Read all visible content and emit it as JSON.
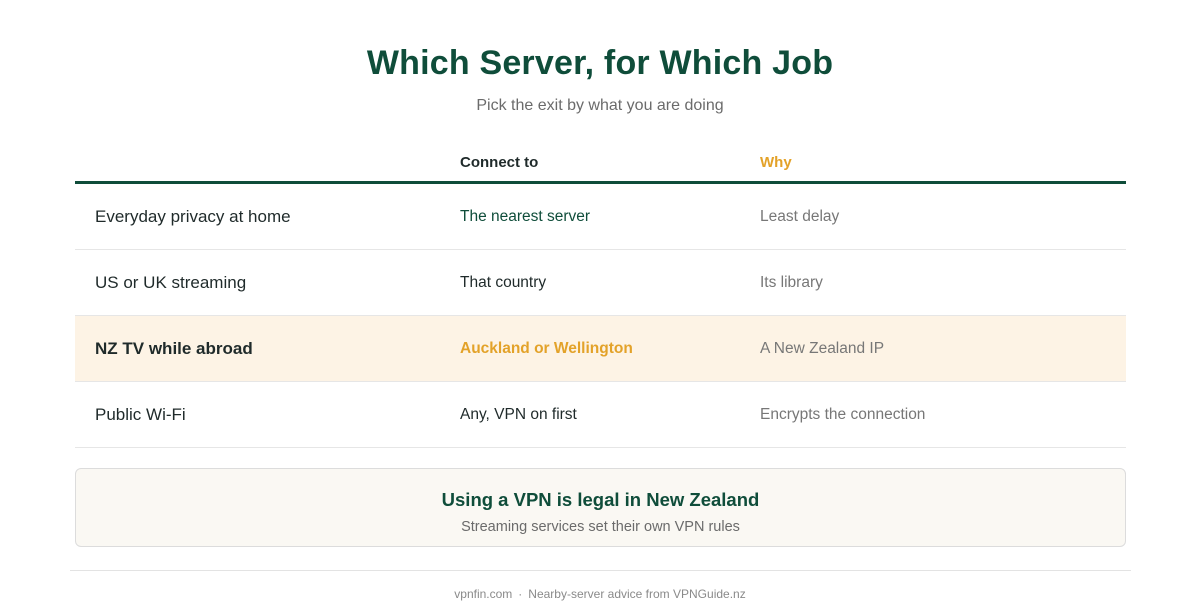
{
  "header": {
    "title": "Which Server, for Which Job",
    "subtitle": "Pick the exit by what you are doing"
  },
  "table": {
    "columns": {
      "job": "",
      "connect": "Connect to",
      "why": "Why"
    },
    "rows": [
      {
        "job": "Everyday privacy at home",
        "connect": "The nearest server",
        "why": "Least delay"
      },
      {
        "job": "US or UK streaming",
        "connect": "That country",
        "why": "Its library"
      },
      {
        "job": "NZ TV while abroad",
        "connect": "Auckland or Wellington",
        "why": "A New Zealand IP",
        "highlighted": true
      },
      {
        "job": "Public Wi-Fi",
        "connect": "Any, VPN on first",
        "why": "Encrypts the connection"
      }
    ]
  },
  "note": {
    "title": "Using a VPN is legal in New Zealand",
    "subtitle": "Streaming services set their own VPN rules"
  },
  "footer": {
    "site": "vpnfin.com",
    "separator": "·",
    "credit": "Nearby-server advice from VPNGuide.nz"
  },
  "colors": {
    "brand_green": "#0f4d3a",
    "accent_amber": "#e3a229",
    "highlight_row_bg": "#fdf3e5",
    "note_bg": "#faf8f3"
  }
}
